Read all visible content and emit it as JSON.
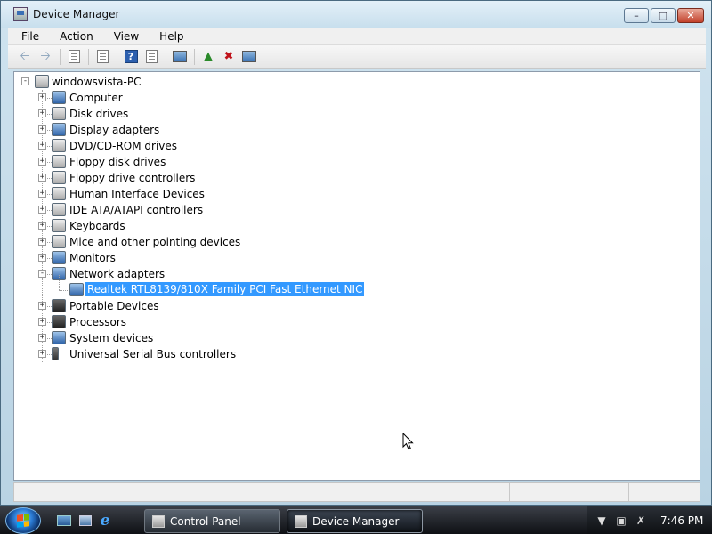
{
  "window": {
    "title": "Device Manager"
  },
  "menu": [
    "File",
    "Action",
    "View",
    "Help"
  ],
  "toolbar": {
    "buttons": [
      "back-icon",
      "forward-icon",
      "show-hide-tree-icon",
      "properties-icon",
      "help-icon",
      "view-icon",
      "scan-icon",
      "update-driver-icon",
      "uninstall-icon",
      "disable-icon"
    ]
  },
  "tree": {
    "root": "windowsvista-PC",
    "categories": [
      "Computer",
      "Disk drives",
      "Display adapters",
      "DVD/CD-ROM drives",
      "Floppy disk drives",
      "Floppy drive controllers",
      "Human Interface Devices",
      "IDE ATA/ATAPI controllers",
      "Keyboards",
      "Mice and other pointing devices",
      "Monitors",
      "Network adapters",
      "Portable Devices",
      "Processors",
      "System devices",
      "Universal Serial Bus controllers"
    ],
    "network_child": "Realtek RTL8139/810X Family PCI Fast Ethernet NIC"
  },
  "taskbar": {
    "tasks": [
      "Control Panel",
      "Device Manager"
    ],
    "clock": "7:46 PM"
  }
}
